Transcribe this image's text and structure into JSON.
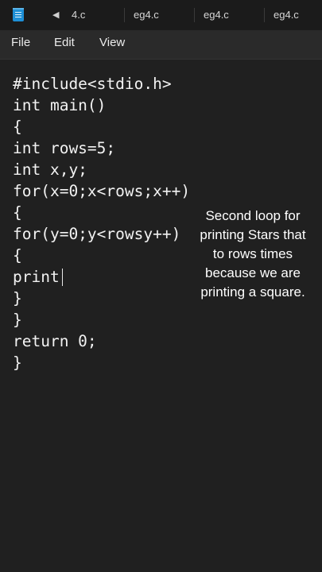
{
  "tabs": [
    "4.c",
    "eg4.c",
    "eg4.c",
    "eg4.c"
  ],
  "menu": [
    "File",
    "Edit",
    "View"
  ],
  "code_lines": [
    "#include<stdio.h>",
    "int main()",
    "{",
    "int rows=5;",
    "int x,y;",
    "for(x=0;x<rows;x++)",
    "{",
    "for(y=0;y<rowsy++)",
    "{",
    "print",
    "}",
    "}",
    "return 0;",
    "}"
  ],
  "annotation_lines": [
    "Second loop for",
    "printing Stars that",
    "to rows times",
    "because we are",
    "printing a square."
  ],
  "icons": {
    "app": "notepad-icon",
    "scroll": "scroll-left-icon"
  },
  "colors": {
    "background": "#202020",
    "text": "#f2f2f2",
    "icon_accent": "#1e8fd6"
  }
}
